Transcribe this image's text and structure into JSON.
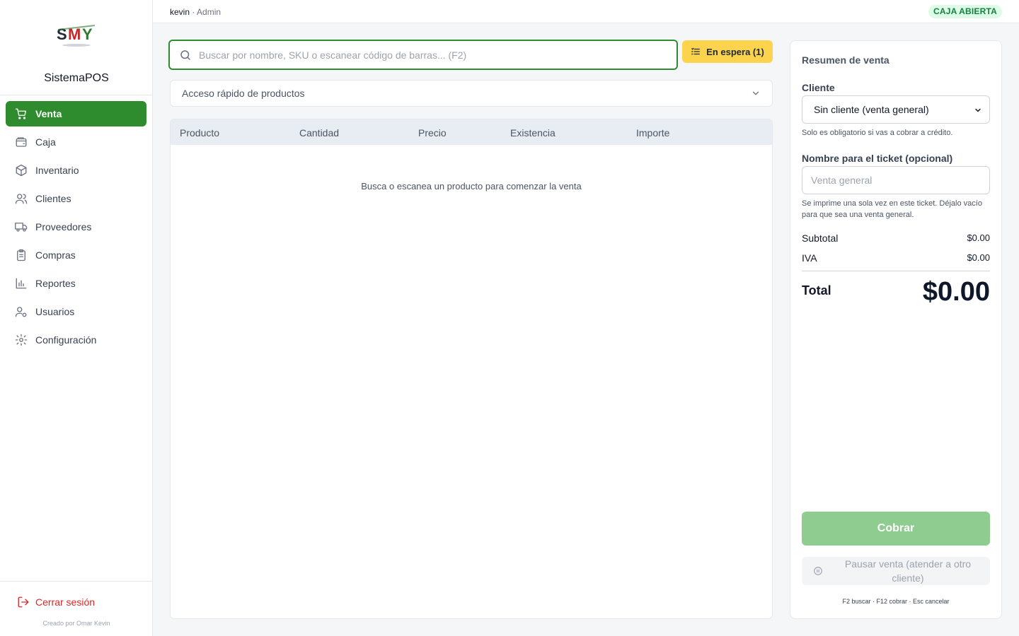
{
  "sidebar": {
    "brand": "SistemaPOS",
    "items": [
      {
        "label": "Venta",
        "icon": "cart-icon",
        "active": true
      },
      {
        "label": "Caja",
        "icon": "wallet-icon"
      },
      {
        "label": "Inventario",
        "icon": "package-icon"
      },
      {
        "label": "Clientes",
        "icon": "users-icon"
      },
      {
        "label": "Proveedores",
        "icon": "truck-icon"
      },
      {
        "label": "Compras",
        "icon": "clipboard-icon"
      },
      {
        "label": "Reportes",
        "icon": "bar-chart-icon"
      },
      {
        "label": "Usuarios",
        "icon": "user-cog-icon"
      },
      {
        "label": "Configuración",
        "icon": "gear-icon"
      }
    ],
    "logout": "Cerrar sesión",
    "credit": "Creado por Omar Kevin"
  },
  "topbar": {
    "user": "kevin",
    "role": "· Admin",
    "status": "CAJA ABIERTA"
  },
  "main": {
    "search_placeholder": "Buscar por nombre, SKU o escanear código de barras... (F2)",
    "hold_button": "En espera (1)",
    "quick_access": "Acceso rápido de productos",
    "table": {
      "headers": [
        "Producto",
        "Cantidad",
        "Precio",
        "Existencia",
        "Importe"
      ],
      "empty": "Busca o escanea un producto para comenzar la venta"
    }
  },
  "summary": {
    "title": "Resumen de venta",
    "client_label": "Cliente",
    "client_value": "Sin cliente (venta general)",
    "client_hint": "Solo es obligatorio si vas a cobrar a crédito.",
    "ticket_label": "Nombre para el ticket (opcional)",
    "ticket_placeholder": "Venta general",
    "ticket_hint": "Se imprime una sola vez en este ticket. Déjalo vacío para que sea una venta general.",
    "subtotal_label": "Subtotal",
    "subtotal_value": "$0.00",
    "iva_label": "IVA",
    "iva_value": "$0.00",
    "total_label": "Total",
    "total_value": "$0.00",
    "charge_button": "Cobrar",
    "pause_button": "Pausar venta (atender a otro cliente)",
    "shortcuts": "F2 buscar · F12 cobrar · Esc cancelar"
  },
  "colors": {
    "accent": "#2e8b2e",
    "hold": "#fcd34d",
    "danger": "#dc2626",
    "status_bg": "#dcfce7"
  }
}
